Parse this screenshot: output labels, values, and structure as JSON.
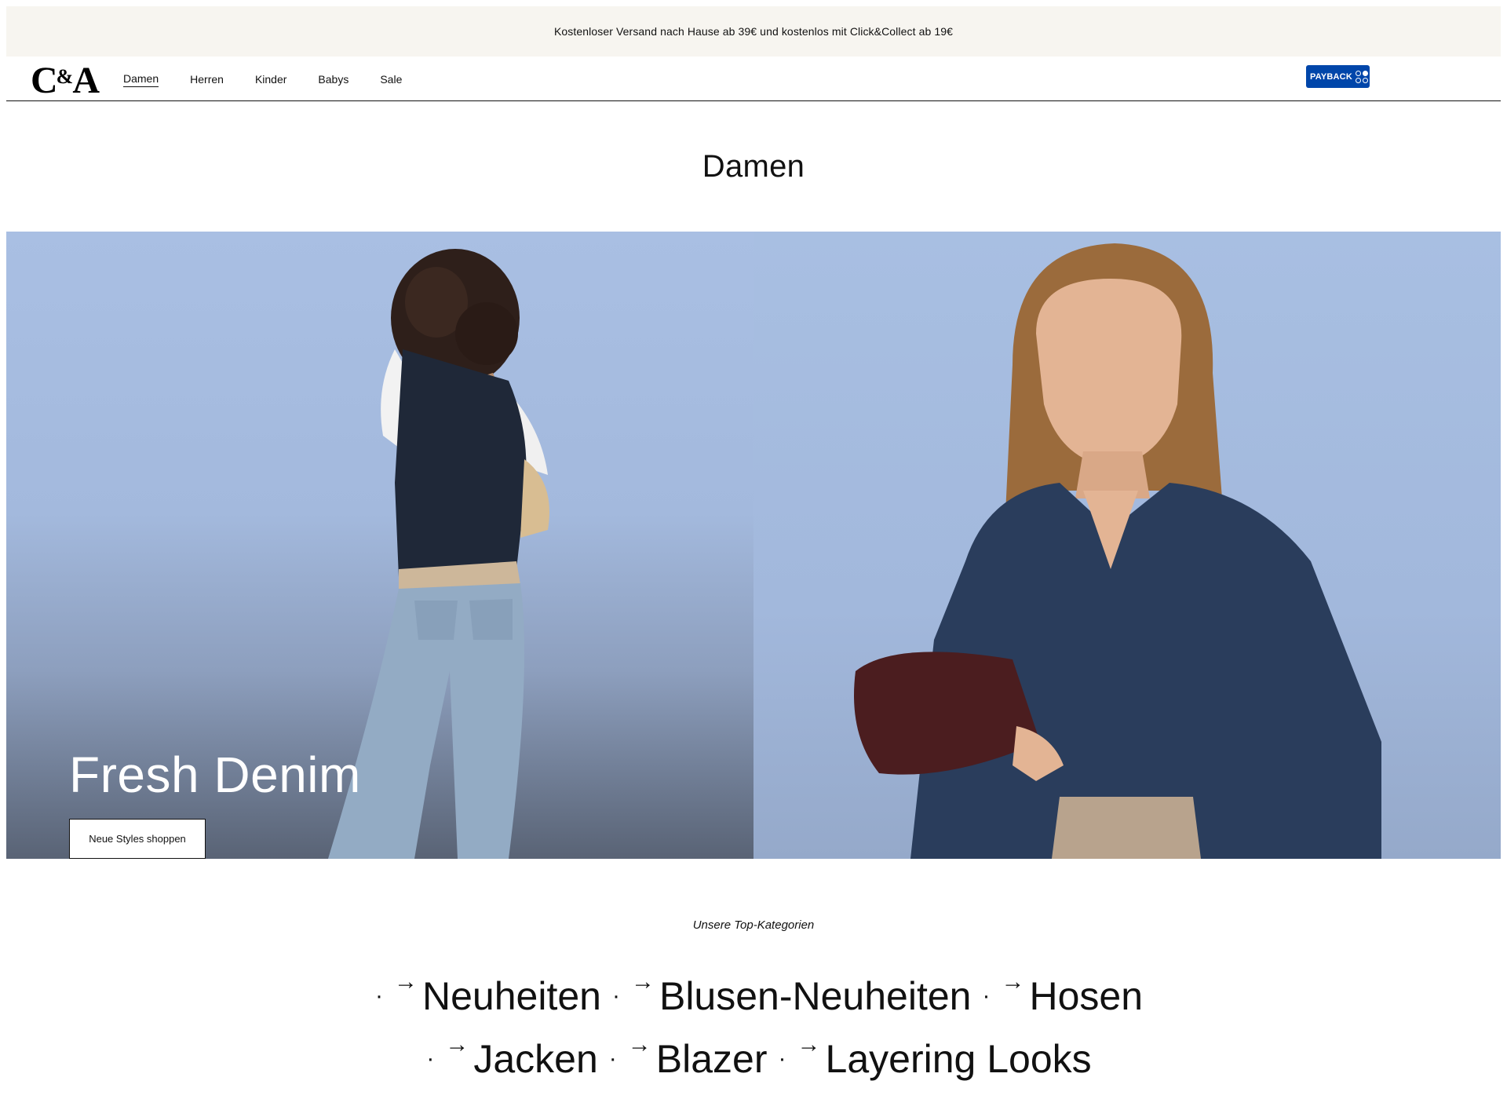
{
  "promo": {
    "text": "Kostenloser Versand nach Hause ab 39€ und kostenlos mit Click&Collect ab 19€"
  },
  "header": {
    "logo": {
      "c": "C",
      "amp": "&",
      "a": "A"
    },
    "nav": [
      "Damen",
      "Herren",
      "Kinder",
      "Babys",
      "Sale"
    ],
    "active_nav": "Damen",
    "payback_label": "PAYBACK"
  },
  "page": {
    "title": "Damen"
  },
  "hero": {
    "title": "Fresh Denim",
    "cta_label": "Neue Styles shoppen"
  },
  "top_categories": {
    "label": "Unsere Top-Kategorien",
    "separator": "·",
    "arrow": "→",
    "row1": [
      "Neuheiten",
      "Blusen-Neuheiten",
      "Hosen"
    ],
    "row2": [
      "Jacken",
      "Blazer",
      "Layering Looks"
    ]
  },
  "colors": {
    "promo_bg": "#f7f5f0",
    "payback_blue": "#0046aa",
    "hero_sky": "#a9bfe3"
  }
}
